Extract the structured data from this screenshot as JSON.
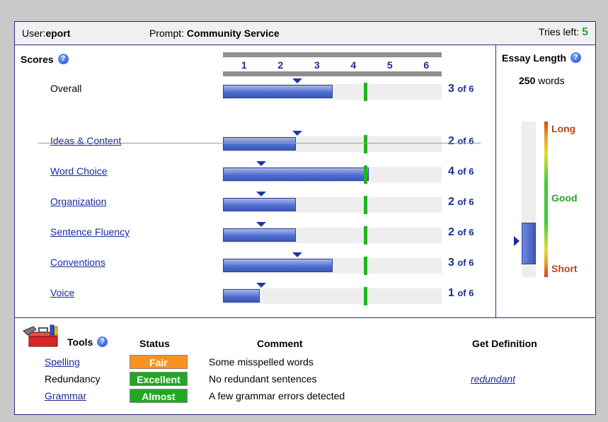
{
  "header": {
    "user_label": "User:",
    "user_value": "eport",
    "prompt_label": "Prompt:",
    "prompt_value": "Community Service",
    "tries_label": "Tries left:",
    "tries_value": "5"
  },
  "scores": {
    "title": "Scores",
    "scale": [
      "1",
      "2",
      "3",
      "4",
      "5",
      "6"
    ],
    "target_level": 4,
    "rows": [
      {
        "label": "Overall",
        "score": 3,
        "fill": 3,
        "marker": 2,
        "of": "of 6",
        "link": false
      },
      {
        "label": "Ideas & Content",
        "score": 2,
        "fill": 2,
        "marker": 2,
        "of": "of 6",
        "link": true
      },
      {
        "label": "Word Choice",
        "score": 4,
        "fill": 4,
        "marker": 1,
        "of": "of 6",
        "link": true
      },
      {
        "label": "Organization",
        "score": 2,
        "fill": 2,
        "marker": 1,
        "of": "of 6",
        "link": true
      },
      {
        "label": "Sentence Fluency",
        "score": 2,
        "fill": 2,
        "marker": 1,
        "of": "of 6",
        "link": true
      },
      {
        "label": "Conventions",
        "score": 3,
        "fill": 3,
        "marker": 2,
        "of": "of 6",
        "link": true
      },
      {
        "label": "Voice",
        "score": 1,
        "fill": 1,
        "marker": 1,
        "of": "of 6",
        "link": true
      }
    ]
  },
  "essay_length": {
    "title": "Essay Length",
    "words_value": "250",
    "words_label": "words",
    "level_fraction": 0.27,
    "long_label": "Long",
    "good_label": "Good",
    "short_label": "Short"
  },
  "tools": {
    "title": "Tools",
    "headers": {
      "status": "Status",
      "comment": "Comment",
      "definition": "Get Definition"
    },
    "rows": [
      {
        "name": "Spelling",
        "link": true,
        "status": "Fair",
        "status_color": "#f7931e",
        "comment": "Some misspelled words",
        "definition": ""
      },
      {
        "name": "Redundancy",
        "link": false,
        "status": "Excellent",
        "status_color": "#22a722",
        "comment": "No redundant sentences",
        "definition": "redundant"
      },
      {
        "name": "Grammar",
        "link": true,
        "status": "Almost",
        "status_color": "#22a722",
        "comment": "A few grammar errors detected",
        "definition": ""
      }
    ]
  },
  "colors": {
    "accent": "#1a2a9a",
    "target_line": "#1fb51f",
    "tries": "#2aa52a"
  }
}
